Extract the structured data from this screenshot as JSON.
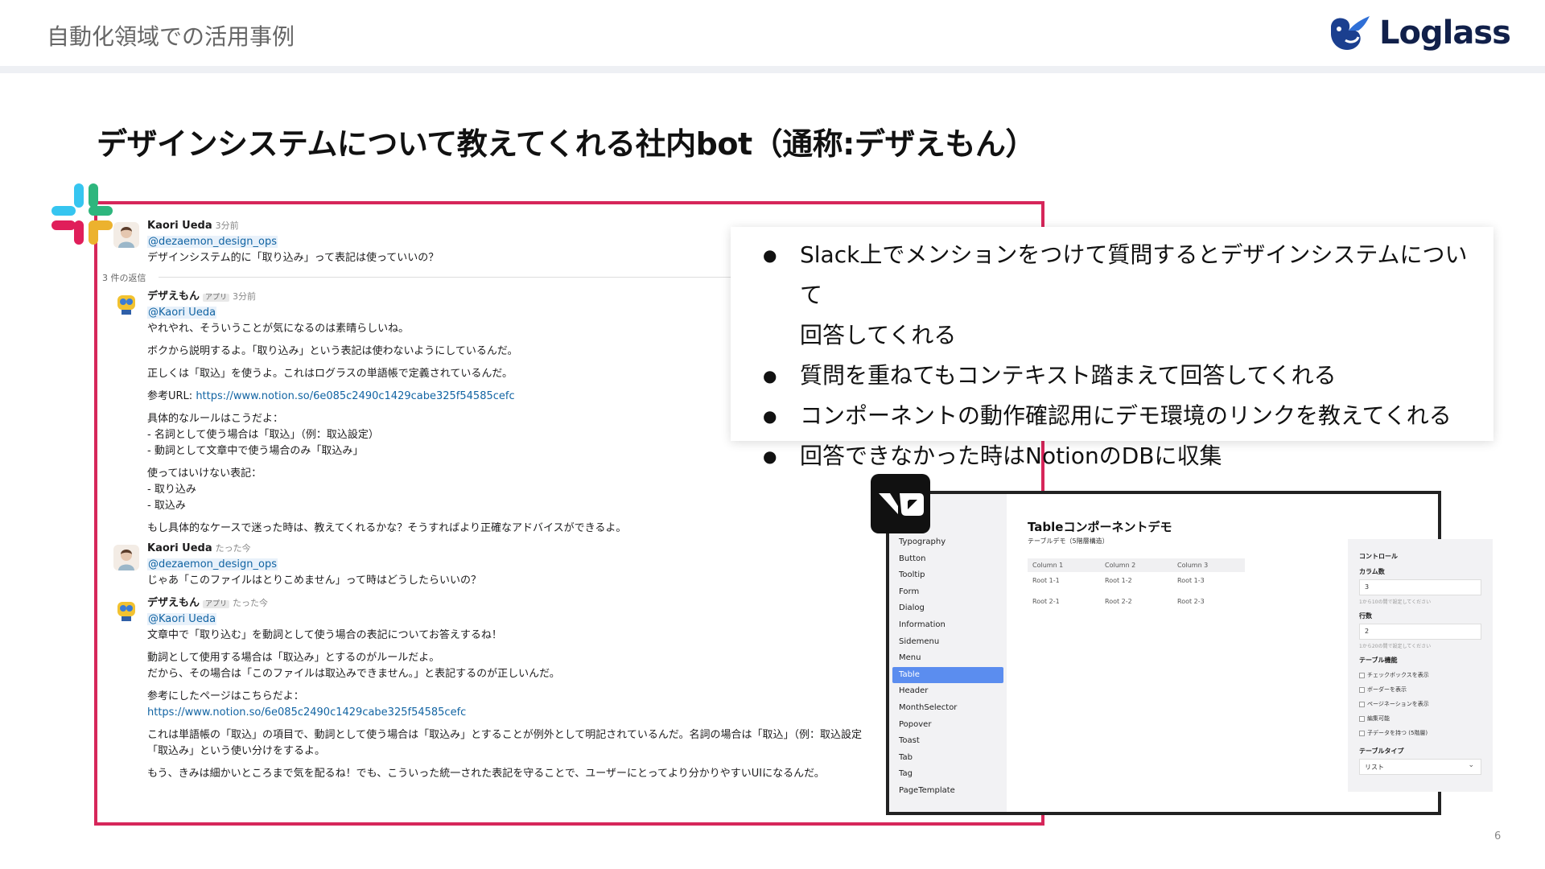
{
  "header": {
    "title": "自動化領域での活用事例",
    "logo_text": "Loglass"
  },
  "slide_title": "デザインシステムについて教えてくれる社内bot（通称:デザえもん）",
  "slack": {
    "messages": [
      {
        "name": "Kaori Ueda",
        "time": "3分前",
        "mention": "@dezaemon_design_ops",
        "lines": [
          "デザインシステム的に「取り込み」って表記は使っていいの？"
        ]
      }
    ],
    "reply_count": "3 件の返信",
    "replies": [
      {
        "name": "デザえもん",
        "app_badge": "アプリ",
        "time": "3分前",
        "mention": "@Kaori Ueda",
        "l1": "やれやれ、そういうことが気になるのは素晴らしいね。",
        "l2": "ボクから説明するよ。「取り込み」という表記は使わないようにしているんだ。",
        "l3": "正しくは「取込」を使うよ。これはログラスの単語帳で定義されているんだ。",
        "l4_prefix": "参考URL: ",
        "l4_link": "https://www.notion.so/6e085c2490c1429cabe325f54585cefc",
        "l5": "具体的なルールはこうだよ：",
        "l6": "- 名詞として使う場合は「取込」（例：取込設定）",
        "l7": "- 動詞として文章中で使う場合のみ「取込み」",
        "l8": "使ってはいけない表記：",
        "l9": "- 取り込み",
        "l10": "- 取込み",
        "l11": "もし具体的なケースで迷った時は、教えてくれるかな？そうすればより正確なアドバイスができるよ。"
      },
      {
        "name": "Kaori Ueda",
        "time": "たった今",
        "mention": "@dezaemon_design_ops",
        "l1": "じゃあ「このファイルはとりこめません」って時はどうしたらいいの？"
      },
      {
        "name": "デザえもん",
        "app_badge": "アプリ",
        "time": "たった今",
        "mention": "@Kaori Ueda",
        "l1": "文章中で「取り込む」を動詞として使う場合の表記についてお答えするね！",
        "l2": "動詞として使用する場合は「取込み」とするのがルールだよ。",
        "l3": "だから、その場合は「このファイルは取込みできません。」と表記するのが正しいんだ。",
        "l4": "参考にしたページはこちらだよ：",
        "l5_link": "https://www.notion.so/6e085c2490c1429cabe325f54585cefc",
        "l6": "これは単語帳の「取込」の項目で、動詞として使う場合は「取込み」とすることが例外として明記されているんだ。名詞の場合は「取込」（例：取込設定",
        "l7": "「取込み」という使い分けをするよ。",
        "l8": "もう、きみは細かいところまで気を配るね！でも、こういった統一された表記を守ることで、ユーザーにとってより分かりやすいUIになるんだ。"
      }
    ]
  },
  "bullets": [
    "Slack上でメンションをつけて質問するとデザインシステムについて",
    "回答してくれる",
    "質問を重ねてもコンテキスト踏まえて回答してくれる",
    "コンポーネントの動作確認用にデモ環境のリンクを教えてくれる",
    "回答できなかった時はNotionのDBに収集"
  ],
  "demo": {
    "logo_text": "V0",
    "sidebar": [
      "Typography",
      "Button",
      "Tooltip",
      "Form",
      "Dialog",
      "Information",
      "Sidemenu",
      "Menu",
      "Table",
      "Header",
      "MonthSelector",
      "Popover",
      "Toast",
      "Tab",
      "Tag",
      "PageTemplate"
    ],
    "active_item": "Table",
    "title": "Tableコンポーネントデモ",
    "subtitle": "テーブルデモ（5階層構造）",
    "columns": [
      "Column 1",
      "Column 2",
      "Column 3"
    ],
    "rows": [
      [
        "Root 1-1",
        "Root 1-2",
        "Root 1-3"
      ],
      [
        "Root 2-1",
        "Root 2-2",
        "Root 2-3"
      ]
    ],
    "panel": {
      "title": "コントロール",
      "col_label": "カラム数",
      "col_value": "3",
      "col_hint": "1から10の間で設定してください",
      "row_label": "行数",
      "row_value": "2",
      "row_hint": "1から20の間で設定してください",
      "features_label": "テーブル機能",
      "features": [
        "チェックボックスを表示",
        "ボーダーを表示",
        "ページネーションを表示",
        "編集可能",
        "子データを持つ (5階層)"
      ],
      "type_label": "テーブルタイプ",
      "type_value": "リスト"
    }
  },
  "page_number": "6",
  "colors": {
    "slack_frame": "#d6265a",
    "link": "#1264a3",
    "active": "#5b8def"
  }
}
